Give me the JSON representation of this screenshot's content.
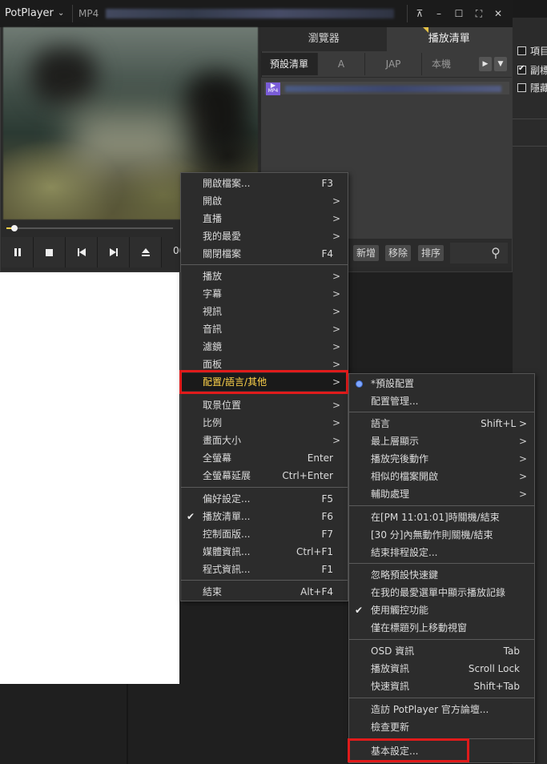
{
  "window": {
    "app_name": "PotPlayer",
    "file_format": "MP4",
    "title_buttons": {
      "pin": "⊼",
      "minimize": "–",
      "maximize": "☐",
      "fullscreen": "⛶",
      "close": "✕"
    }
  },
  "playlist": {
    "tabs": [
      "瀏覽器",
      "播放清單"
    ],
    "active_tab": "播放清單",
    "subtabs": [
      "預設清單",
      "A",
      "JAP",
      "本機"
    ],
    "item_badge": "MP4",
    "footer_buttons": [
      "新增",
      "移除",
      "排序"
    ]
  },
  "controls": {
    "time_text": "00",
    "buttons": [
      "pause",
      "stop",
      "previous",
      "next",
      "eject"
    ]
  },
  "side_options": [
    "項目",
    "副標",
    "隱藏"
  ],
  "main_menu": {
    "items": [
      {
        "label": "開啟檔案...",
        "shortcut": "F3"
      },
      {
        "label": "開啟",
        "submenu": true
      },
      {
        "label": "直播",
        "submenu": true
      },
      {
        "label": "我的最愛",
        "submenu": true
      },
      {
        "label": "關閉檔案",
        "shortcut": "F4"
      },
      {
        "label": "播放",
        "submenu": true
      },
      {
        "label": "字幕",
        "submenu": true
      },
      {
        "label": "視訊",
        "submenu": true
      },
      {
        "label": "音訊",
        "submenu": true
      },
      {
        "label": "濾鏡",
        "submenu": true
      },
      {
        "label": "面板",
        "submenu": true
      },
      {
        "label": "配置/語言/其他",
        "submenu": true,
        "highlighted": true
      },
      {
        "label": "取景位置",
        "submenu": true
      },
      {
        "label": "比例",
        "submenu": true
      },
      {
        "label": "畫面大小",
        "submenu": true
      },
      {
        "label": "全螢幕",
        "shortcut": "Enter"
      },
      {
        "label": "全螢幕延展",
        "shortcut": "Ctrl+Enter"
      },
      {
        "label": "偏好設定...",
        "shortcut": "F5"
      },
      {
        "label": "播放清單...",
        "shortcut": "F6",
        "checked": true
      },
      {
        "label": "控制面版...",
        "shortcut": "F7"
      },
      {
        "label": "媒體資訊...",
        "shortcut": "Ctrl+F1"
      },
      {
        "label": "程式資訊...",
        "shortcut": "F1"
      },
      {
        "label": "結束",
        "shortcut": "Alt+F4"
      }
    ]
  },
  "sub_menu": {
    "items": [
      {
        "label": "*預設配置",
        "radio": true
      },
      {
        "label": "配置管理..."
      },
      {
        "label": "語言",
        "shortcut": "Shift+L >"
      },
      {
        "label": "最上層顯示",
        "submenu": true
      },
      {
        "label": "播放完後動作",
        "submenu": true
      },
      {
        "label": "相似的檔案開啟",
        "submenu": true
      },
      {
        "label": "輔助處理",
        "submenu": true
      },
      {
        "label": "在[PM 11:01:01]時關機/結束"
      },
      {
        "label": "[30 分]內無動作則關機/結束"
      },
      {
        "label": "結束排程設定..."
      },
      {
        "label": "忽略預設快速鍵"
      },
      {
        "label": "在我的最愛選單中顯示播放記錄"
      },
      {
        "label": "使用觸控功能",
        "checked": true
      },
      {
        "label": "僅在標題列上移動視窗"
      },
      {
        "label": "OSD 資訊",
        "shortcut": "Tab"
      },
      {
        "label": "播放資訊",
        "shortcut": "Scroll Lock"
      },
      {
        "label": "快速資訊",
        "shortcut": "Shift+Tab"
      },
      {
        "label": "造訪 PotPlayer 官方論壇..."
      },
      {
        "label": "檢查更新"
      },
      {
        "label": "基本設定..."
      }
    ]
  },
  "colors": {
    "highlight_text": "#ffd34a",
    "annotation_box": "#e01b1b",
    "menu_bg": "#2c2c2c",
    "accent_badge": "#7a5dd8"
  }
}
